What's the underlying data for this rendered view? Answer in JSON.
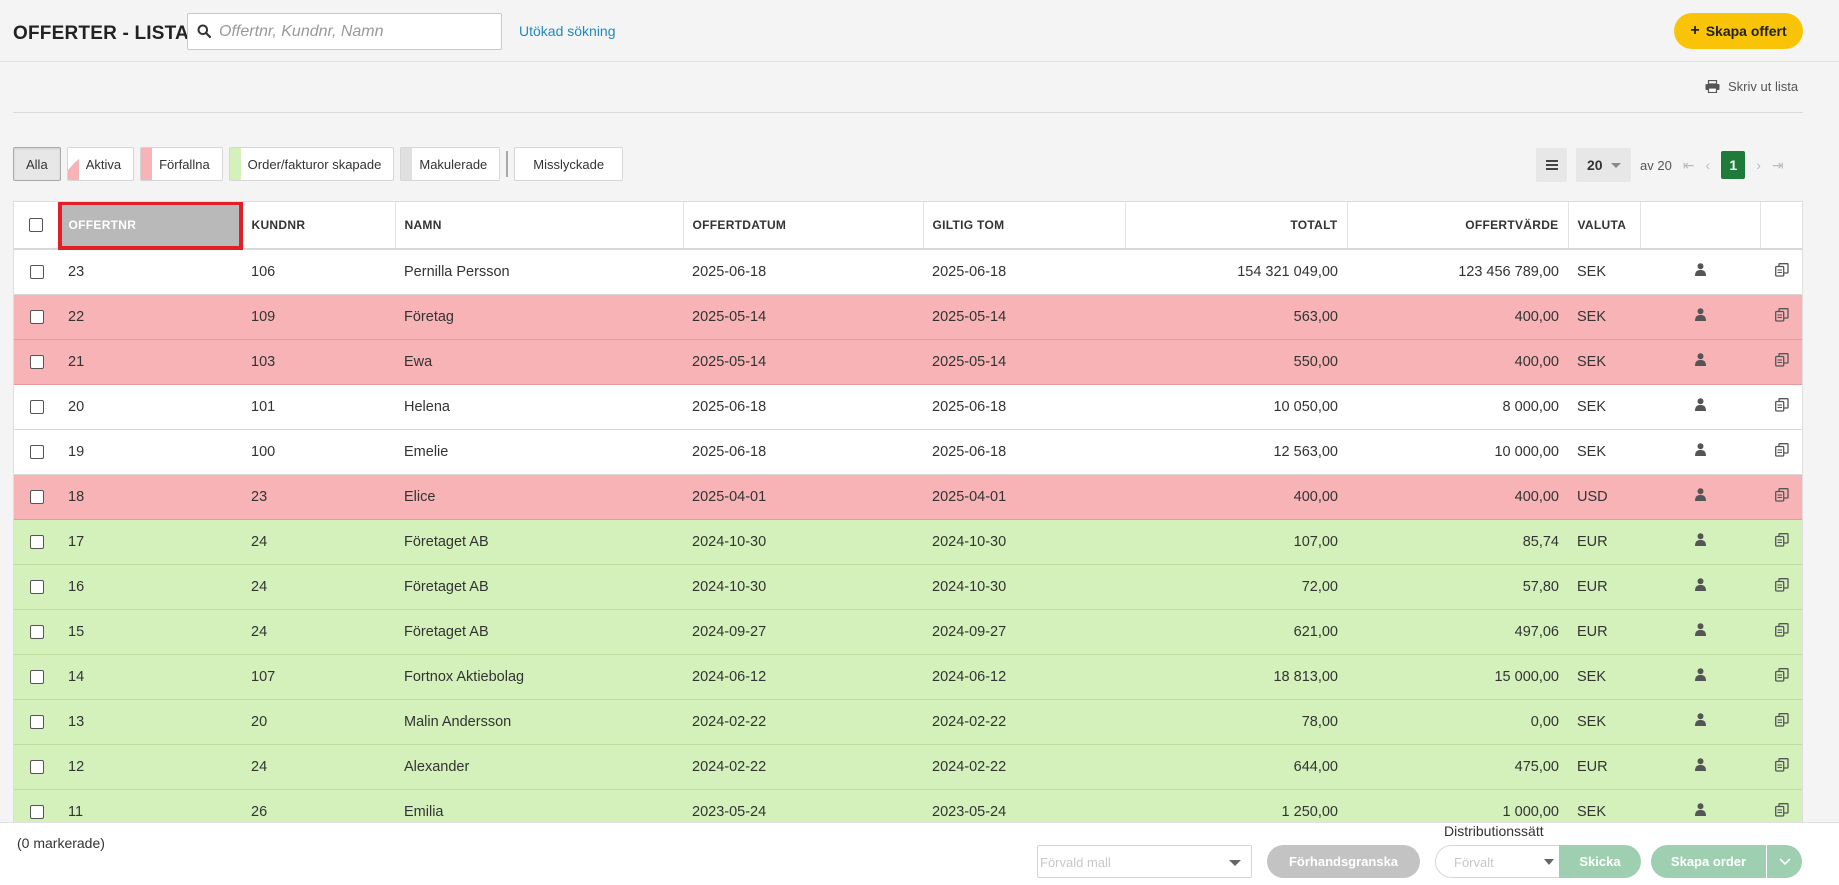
{
  "header": {
    "title": "OFFERTER - LISTA",
    "search_placeholder": "Offertnr, Kundnr, Namn",
    "advanced_search": "Utökad sökning",
    "create_label": "Skapa offert"
  },
  "print_label": "Skriv ut lista",
  "filters": [
    {
      "label": "Alla",
      "color": ""
    },
    {
      "label": "Aktiva",
      "color": "#f7b3b6"
    },
    {
      "label": "Förfallna",
      "color": "#f7b3b6"
    },
    {
      "label": "Order/fakturor skapade",
      "color": "#d4f1bb"
    },
    {
      "label": "Makulerade",
      "color": "#e0e0e0"
    },
    {
      "label": "Misslyckade",
      "color": ""
    }
  ],
  "pager": {
    "page_size": "20",
    "of_text": "av 20",
    "current_page": "1"
  },
  "columns": {
    "offertnr": "OFFERTNR",
    "kundnr": "KUNDNR",
    "namn": "NAMN",
    "offertdatum": "OFFERTDATUM",
    "giltig_tom": "GILTIG TOM",
    "totalt": "TOTALT",
    "offertvarde": "OFFERTVÄRDE",
    "valuta": "VALUTA"
  },
  "rows": [
    {
      "status": "white",
      "offertnr": "23",
      "kundnr": "106",
      "namn": "Pernilla Persson",
      "offertdatum": "2025-06-18",
      "giltig_tom": "2025-06-18",
      "totalt": "154 321 049,00",
      "offertvarde": "123 456 789,00",
      "valuta": "SEK"
    },
    {
      "status": "red",
      "offertnr": "22",
      "kundnr": "109",
      "namn": "Företag",
      "offertdatum": "2025-05-14",
      "giltig_tom": "2025-05-14",
      "totalt": "563,00",
      "offertvarde": "400,00",
      "valuta": "SEK"
    },
    {
      "status": "red",
      "offertnr": "21",
      "kundnr": "103",
      "namn": "Ewa",
      "offertdatum": "2025-05-14",
      "giltig_tom": "2025-05-14",
      "totalt": "550,00",
      "offertvarde": "400,00",
      "valuta": "SEK"
    },
    {
      "status": "white",
      "offertnr": "20",
      "kundnr": "101",
      "namn": "Helena",
      "offertdatum": "2025-06-18",
      "giltig_tom": "2025-06-18",
      "totalt": "10 050,00",
      "offertvarde": "8 000,00",
      "valuta": "SEK"
    },
    {
      "status": "white",
      "offertnr": "19",
      "kundnr": "100",
      "namn": "Emelie",
      "offertdatum": "2025-06-18",
      "giltig_tom": "2025-06-18",
      "totalt": "12 563,00",
      "offertvarde": "10 000,00",
      "valuta": "SEK"
    },
    {
      "status": "red",
      "offertnr": "18",
      "kundnr": "23",
      "namn": "Elice",
      "offertdatum": "2025-04-01",
      "giltig_tom": "2025-04-01",
      "totalt": "400,00",
      "offertvarde": "400,00",
      "valuta": "USD"
    },
    {
      "status": "green",
      "offertnr": "17",
      "kundnr": "24",
      "namn": "Företaget AB",
      "offertdatum": "2024-10-30",
      "giltig_tom": "2024-10-30",
      "totalt": "107,00",
      "offertvarde": "85,74",
      "valuta": "EUR"
    },
    {
      "status": "green",
      "offertnr": "16",
      "kundnr": "24",
      "namn": "Företaget AB",
      "offertdatum": "2024-10-30",
      "giltig_tom": "2024-10-30",
      "totalt": "72,00",
      "offertvarde": "57,80",
      "valuta": "EUR"
    },
    {
      "status": "green",
      "offertnr": "15",
      "kundnr": "24",
      "namn": "Företaget AB",
      "offertdatum": "2024-09-27",
      "giltig_tom": "2024-09-27",
      "totalt": "621,00",
      "offertvarde": "497,06",
      "valuta": "EUR"
    },
    {
      "status": "green",
      "offertnr": "14",
      "kundnr": "107",
      "namn": "Fortnox Aktiebolag",
      "offertdatum": "2024-06-12",
      "giltig_tom": "2024-06-12",
      "totalt": "18 813,00",
      "offertvarde": "15 000,00",
      "valuta": "SEK"
    },
    {
      "status": "green",
      "offertnr": "13",
      "kundnr": "20",
      "namn": "Malin Andersson",
      "offertdatum": "2024-02-22",
      "giltig_tom": "2024-02-22",
      "totalt": "78,00",
      "offertvarde": "0,00",
      "valuta": "SEK"
    },
    {
      "status": "green",
      "offertnr": "12",
      "kundnr": "24",
      "namn": "Alexander",
      "offertdatum": "2024-02-22",
      "giltig_tom": "2024-02-22",
      "totalt": "644,00",
      "offertvarde": "475,00",
      "valuta": "EUR"
    },
    {
      "status": "green",
      "offertnr": "11",
      "kundnr": "26",
      "namn": "Emilia",
      "offertdatum": "2023-05-24",
      "giltig_tom": "2023-05-24",
      "totalt": "1 250,00",
      "offertvarde": "1 000,00",
      "valuta": "SEK"
    }
  ],
  "bottom": {
    "marked": "(0 markerade)",
    "distribution_label": "Distributionssätt",
    "template_placeholder": "Förvald mall",
    "preview_label": "Förhandsgranska",
    "distribution_placeholder": "Förvalt",
    "send_label": "Skicka",
    "create_order_label": "Skapa order"
  },
  "icons": {
    "search": "search-icon",
    "print": "printer-icon",
    "list": "list-icon",
    "user": "user-icon",
    "copy": "copy-icon"
  }
}
